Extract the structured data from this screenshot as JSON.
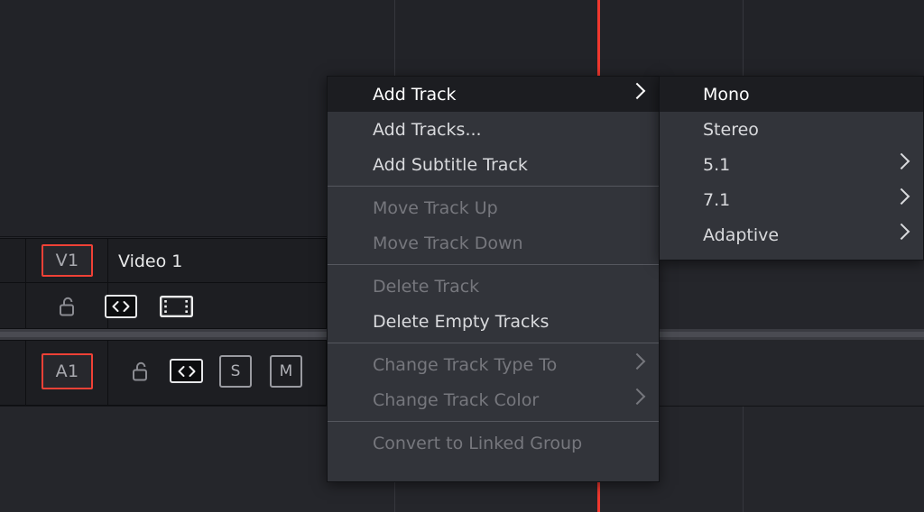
{
  "app": {
    "name": "video-editor-timeline",
    "accent_red": "#ef4136",
    "playhead_color": "#f0382f",
    "menu_bg": "#32343a",
    "menu_highlight_bg": "#1c1d21",
    "panel_bg": "#1d1e22",
    "timeline_bg": "#25262b"
  },
  "timeline": {
    "tracks": [
      {
        "id": "V1",
        "label": "V1",
        "name": "Video 1",
        "controls": [
          {
            "icon": "lock-open-icon",
            "label": "",
            "style": "plain",
            "active": false
          },
          {
            "icon": "auto-select-icon",
            "label": "<>",
            "style": "boxed-bright",
            "active": true
          },
          {
            "icon": "video-track-icon",
            "label": "",
            "style": "boxed-bright",
            "active": true
          }
        ]
      },
      {
        "id": "A1",
        "label": "A1",
        "name": "",
        "controls": [
          {
            "icon": "lock-open-icon",
            "label": "",
            "style": "plain",
            "active": false
          },
          {
            "icon": "auto-select-icon",
            "label": "<>",
            "style": "boxed-bright",
            "active": true
          },
          {
            "icon": "solo-icon",
            "label": "S",
            "style": "boxed",
            "active": false
          },
          {
            "icon": "mute-icon",
            "label": "M",
            "style": "boxed",
            "active": false
          }
        ]
      }
    ]
  },
  "context_menu": {
    "name": "track-context-menu",
    "items": [
      {
        "label": "Add Track",
        "state": "selected",
        "submenu": true
      },
      {
        "label": "Add Tracks...",
        "state": "enabled",
        "submenu": false
      },
      {
        "label": "Add Subtitle Track",
        "state": "enabled",
        "submenu": false
      },
      {
        "separator": true
      },
      {
        "label": "Move Track Up",
        "state": "disabled",
        "submenu": false
      },
      {
        "label": "Move Track Down",
        "state": "disabled",
        "submenu": false
      },
      {
        "separator": true
      },
      {
        "label": "Delete Track",
        "state": "disabled",
        "submenu": false
      },
      {
        "label": "Delete Empty Tracks",
        "state": "enabled",
        "submenu": false
      },
      {
        "separator": true
      },
      {
        "label": "Change Track Type To",
        "state": "disabled",
        "submenu": true
      },
      {
        "label": "Change Track Color",
        "state": "disabled",
        "submenu": true
      },
      {
        "separator": true
      },
      {
        "label": "Convert to Linked Group",
        "state": "disabled",
        "submenu": false
      }
    ]
  },
  "submenu": {
    "name": "add-track-submenu",
    "items": [
      {
        "label": "Mono",
        "state": "selected",
        "submenu": false
      },
      {
        "label": "Stereo",
        "state": "enabled",
        "submenu": false
      },
      {
        "label": "5.1",
        "state": "enabled",
        "submenu": true
      },
      {
        "label": "7.1",
        "state": "enabled",
        "submenu": true
      },
      {
        "label": "Adaptive",
        "state": "enabled",
        "submenu": true
      }
    ]
  }
}
